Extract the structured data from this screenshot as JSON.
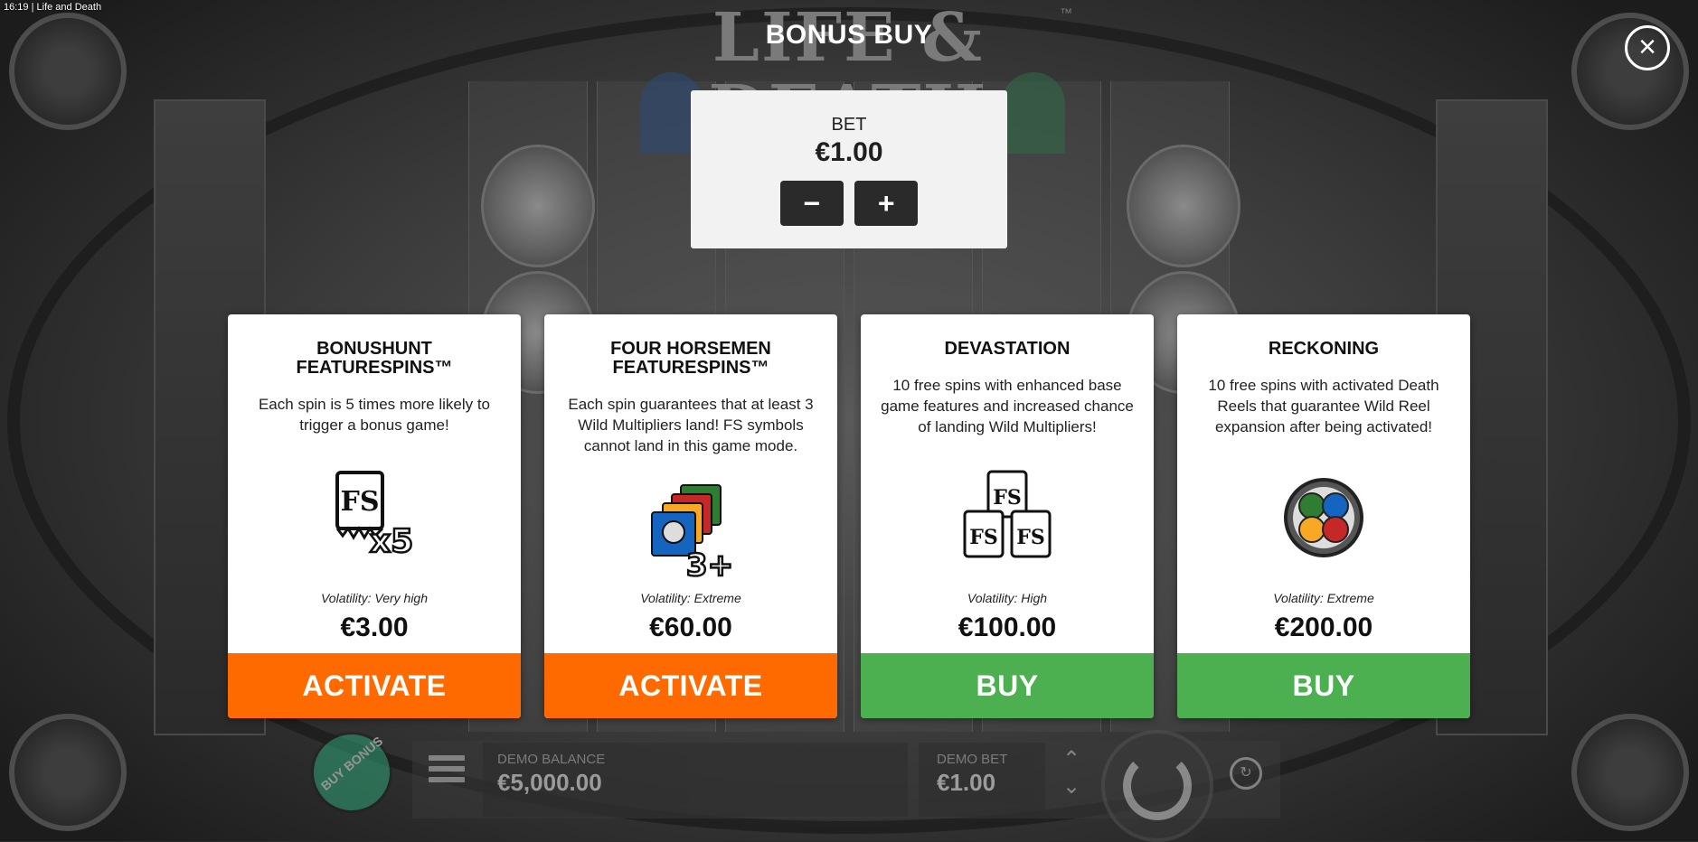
{
  "status_bar": {
    "time": "16:19",
    "app_name": "Life and Death"
  },
  "background": {
    "game_logo": "LIFE & DEATH",
    "trademark": "™"
  },
  "modal": {
    "title": "BONUS BUY",
    "close_icon": "×",
    "bet": {
      "label": "BET",
      "value": "€1.00",
      "decrease_symbol": "−",
      "increase_symbol": "+"
    },
    "cards": [
      {
        "title": "BONUSHUNT FEATURESPINS™",
        "description": "Each spin is 5 times more likely to trigger a bonus game!",
        "icon": "fs-x5-icon",
        "volatility": "Volatility: Very high",
        "price": "€3.00",
        "button_label": "ACTIVATE",
        "button_color": "#ff6a00"
      },
      {
        "title": "FOUR HORSEMEN FEATURESPINS™",
        "description": "Each spin guarantees that at least 3 Wild Multipliers land! FS symbols cannot land in this game mode.",
        "icon": "horsemen-3plus-icon",
        "volatility": "Volatility: Extreme",
        "price": "€60.00",
        "button_label": "ACTIVATE",
        "button_color": "#ff6a00"
      },
      {
        "title": "DEVASTATION",
        "description": "10 free spins with enhanced base game features and increased chance of landing Wild Multipliers!",
        "icon": "fs-triple-icon",
        "volatility": "Volatility: High",
        "price": "€100.00",
        "button_label": "BUY",
        "button_color": "#4caf50"
      },
      {
        "title": "RECKONING",
        "description": "10 free spins with activated Death Reels that guarantee Wild Reel expansion after being activated!",
        "icon": "stained-glass-medallion-icon",
        "volatility": "Volatility: Extreme",
        "price": "€200.00",
        "button_label": "BUY",
        "button_color": "#4caf50"
      }
    ]
  },
  "bottom_bar": {
    "buy_bonus_label": "BUY BONUS",
    "demo_balance_label": "DEMO BALANCE",
    "demo_balance_value": "€5,000.00",
    "demo_bet_label": "DEMO BET",
    "demo_bet_value": "€1.00"
  }
}
